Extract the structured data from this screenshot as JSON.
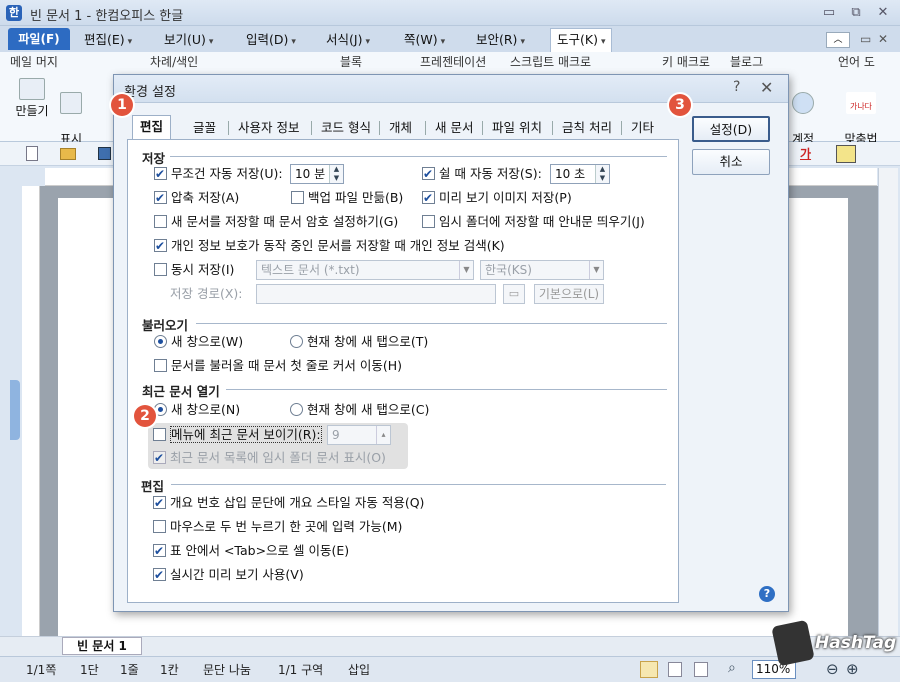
{
  "window": {
    "title": "빈 문서 1 - 한컴오피스 한글",
    "app_icon": "한"
  },
  "menu": {
    "items": [
      {
        "label": "파일(F)",
        "caret": ""
      },
      {
        "label": "편집(E)",
        "caret": "▾"
      },
      {
        "label": "보기(U)",
        "caret": "▾"
      },
      {
        "label": "입력(D)",
        "caret": "▾"
      },
      {
        "label": "서식(J)",
        "caret": "▾"
      },
      {
        "label": "쪽(W)",
        "caret": "▾"
      },
      {
        "label": "보안(R)",
        "caret": "▾"
      },
      {
        "label": "도구(K)",
        "caret": "▾"
      }
    ]
  },
  "ribbon": {
    "groups": [
      "메일 머지",
      "차례/색인",
      "블록",
      "프레젠테이션",
      "스크립트 매크로",
      "키 매크로",
      "블로그",
      "언어 도"
    ],
    "buttons": {
      "make": "만들기",
      "show": "표시\n달기",
      "account": "계정\n선택",
      "spellcheck": "맞춤법\n검사",
      "spellcheck_icon_text": "가나다"
    }
  },
  "document": {
    "tab_name": "빈 문서 1"
  },
  "status": {
    "page": "1/1쪽",
    "section": "1단",
    "line": "1줄",
    "col": "1칸",
    "split": "문단 나눔",
    "area": "1/1 구역",
    "insert": "삽입",
    "zoom": "110%"
  },
  "dialog": {
    "title": "환경 설정",
    "help": "?",
    "close": "✕",
    "tabs": [
      "편집",
      "글꼴",
      "사용자 정보",
      "코드 형식",
      "개체",
      "새 문서",
      "파일 위치",
      "금칙 처리",
      "기타"
    ],
    "buttons": {
      "settings": "설정(D)",
      "cancel": "취소"
    },
    "save": {
      "header": "저장",
      "auto_save": "무조건 자동 저장(U):",
      "auto_save_value": "10 분",
      "idle_save": "쉴 때 자동 저장(S):",
      "idle_save_value": "10 초",
      "compress": "압축 저장(A)",
      "backup": "백업 파일 만듦(B)",
      "preview_image": "미리 보기 이미지 저장(P)",
      "password": "새 문서를 저장할 때 문서 암호 설정하기(G)",
      "temp_notice": "임시 폴더에 저장할 때 안내문 띄우기(J)",
      "privacy": "개인 정보 보호가 동작 중인 문서를 저장할 때 개인 정보 검색(K)",
      "simul_save": "동시 저장(I)",
      "simul_format": "텍스트 문서 (*.txt)",
      "simul_encoding": "한국(KS)",
      "save_path": "저장 경로(X):",
      "default_btn": "기본으로(L)"
    },
    "open": {
      "header": "불러오기",
      "new_window": "새 창으로(W)",
      "new_tab": "현재 창에 새 탭으로(T)",
      "cursor_first": "문서를 불러올 때 문서 첫 줄로 커서 이동(H)"
    },
    "recent": {
      "header": "최근 문서 열기",
      "new_window": "새 창으로(N)",
      "new_tab": "현재 창에 새 탭으로(C)",
      "show_menu": "메뉴에 최근 문서 보이기(R):",
      "show_menu_value": "9",
      "temp_folder": "최근 문서 목록에 임시 폴더 문서 표시(O)"
    },
    "edit": {
      "header": "편집",
      "outline": "개요 번호 삽입 문단에 개요 스타일 자동 적용(Q)",
      "double_click": "마우스로 두 번 누르기 한 곳에 입력 가능(M)",
      "table_tab": "표 안에서 <Tab>으로 셀 이동(E)",
      "live_preview": "실시간 미리 보기 사용(V)"
    }
  },
  "annotations": {
    "b1": "1",
    "b2": "2",
    "b3": "3"
  },
  "watermark": {
    "text": "HashTag"
  }
}
